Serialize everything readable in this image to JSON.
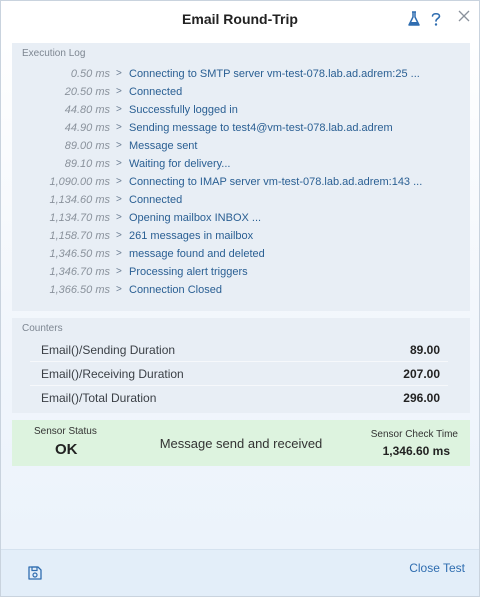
{
  "window": {
    "title": "Email Round-Trip"
  },
  "execution_log": {
    "title": "Execution Log",
    "entries": [
      {
        "time": "0.50 ms",
        "message": "Connecting to SMTP server vm-test-078.lab.ad.adrem:25 ..."
      },
      {
        "time": "20.50 ms",
        "message": "Connected"
      },
      {
        "time": "44.80 ms",
        "message": "Successfully logged in"
      },
      {
        "time": "44.90 ms",
        "message": "Sending message to test4@vm-test-078.lab.ad.adrem"
      },
      {
        "time": "89.00 ms",
        "message": "Message sent"
      },
      {
        "time": "89.10 ms",
        "message": "Waiting for delivery..."
      },
      {
        "time": "1,090.00 ms",
        "message": "Connecting to IMAP server vm-test-078.lab.ad.adrem:143 ..."
      },
      {
        "time": "1,134.60 ms",
        "message": "Connected"
      },
      {
        "time": "1,134.70 ms",
        "message": "Opening mailbox INBOX ..."
      },
      {
        "time": "1,158.70 ms",
        "message": "261 messages in mailbox"
      },
      {
        "time": "1,346.50 ms",
        "message": "message found and deleted"
      },
      {
        "time": "1,346.70 ms",
        "message": "Processing alert triggers"
      },
      {
        "time": "1,366.50 ms",
        "message": "Connection Closed"
      }
    ]
  },
  "counters": {
    "title": "Counters",
    "rows": [
      {
        "label": "Email()/Sending Duration",
        "value": "89.00"
      },
      {
        "label": "Email()/Receiving Duration",
        "value": "207.00"
      },
      {
        "label": "Email()/Total Duration",
        "value": "296.00"
      }
    ]
  },
  "status": {
    "sensor_status_label": "Sensor Status",
    "sensor_status_value": "OK",
    "message": "Message send and received",
    "check_time_label": "Sensor Check Time",
    "check_time_value": "1,346.60 ms",
    "color": "#ddf3df"
  },
  "footer": {
    "close_label": "Close Test",
    "save_icon": "save-icon"
  },
  "colors": {
    "accent": "#2f6db0",
    "log_text": "#2a5f93",
    "panel_bg": "#e8eef5"
  }
}
